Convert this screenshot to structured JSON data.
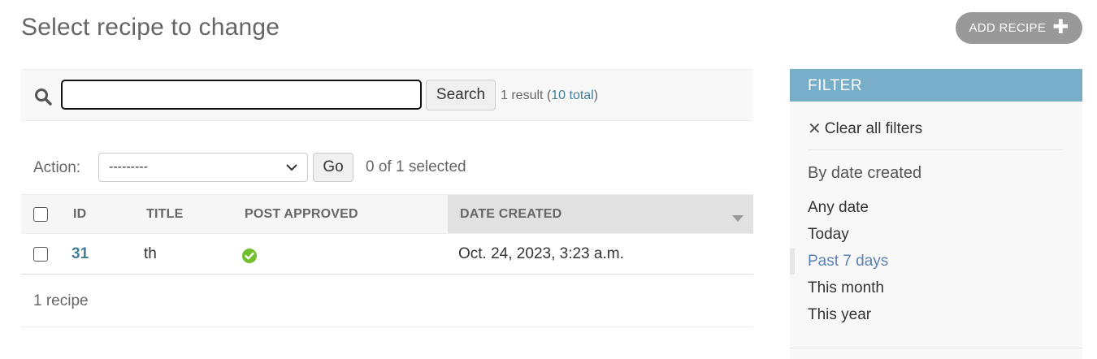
{
  "page": {
    "title": "Select recipe to change"
  },
  "header": {
    "add_label": "ADD RECIPE",
    "add_icon": "plus-icon"
  },
  "search": {
    "icon": "search-icon",
    "value": "",
    "placeholder": "",
    "button_label": "Search",
    "result_prefix": "1 result (",
    "result_total_link": "10 total",
    "result_suffix": ")"
  },
  "actions": {
    "label": "Action:",
    "selected_option": "---------",
    "go_label": "Go",
    "selected_count": "0 of 1 selected"
  },
  "table": {
    "columns": [
      "ID",
      "TITLE",
      "POST APPROVED",
      "DATE CREATED"
    ],
    "sorted_column": "DATE CREATED",
    "rows": [
      {
        "id": "31",
        "title": "th",
        "post_approved": true,
        "date_created": "Oct. 24, 2023, 3:23 a.m."
      }
    ],
    "footer": "1 recipe"
  },
  "filter": {
    "header": "FILTER",
    "clear_label": "Clear all filters",
    "group_title": "By date created",
    "options": [
      "Any date",
      "Today",
      "Past 7 days",
      "This month",
      "This year"
    ],
    "selected_option": "Past 7 days"
  },
  "colors": {
    "accent": "#79aec8",
    "link": "#447e9b",
    "selected_filter": "#5b80b2",
    "check_green": "#70bf2b",
    "add_button": "#999999"
  }
}
